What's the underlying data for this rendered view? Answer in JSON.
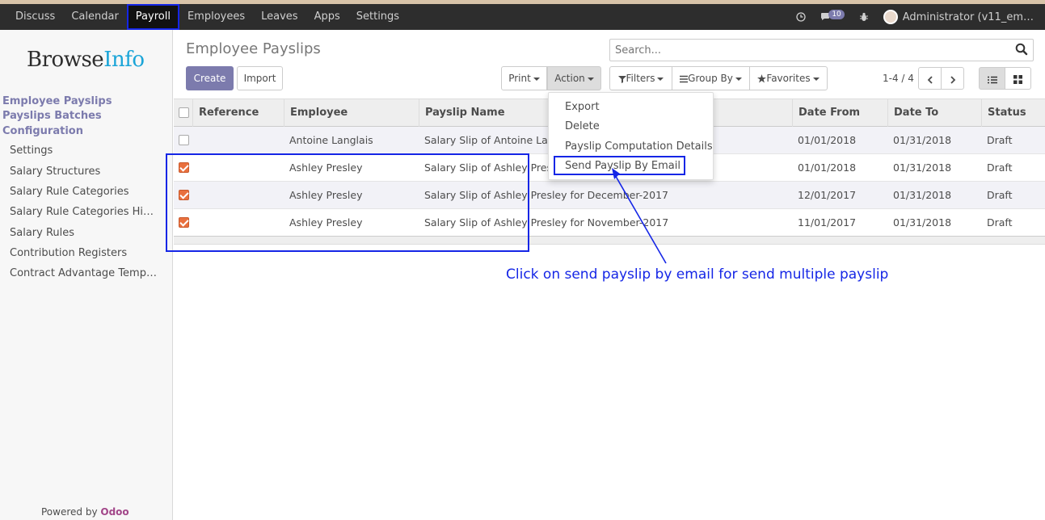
{
  "navbar": {
    "items": [
      "Discuss",
      "Calendar",
      "Payroll",
      "Employees",
      "Leaves",
      "Apps",
      "Settings"
    ],
    "active": "Payroll",
    "message_count": "10",
    "user": "Administrator (v11_em…"
  },
  "sidebar": {
    "logo_part1": "Browse",
    "logo_part2": "Info",
    "headings": [
      "Employee Payslips",
      "Payslips Batches",
      "Configuration"
    ],
    "items": [
      "Settings",
      "Salary Structures",
      "Salary Rule Categories",
      "Salary Rule Categories Hi…",
      "Salary Rules",
      "Contribution Registers",
      "Contract Advantage Temp…"
    ],
    "powered_by": "Powered by",
    "powered_brand": "Odoo"
  },
  "control": {
    "title": "Employee Payslips",
    "search_placeholder": "Search...",
    "create": "Create",
    "import": "Import",
    "print": "Print",
    "action": "Action",
    "filters": "Filters",
    "group_by": "Group By",
    "favorites": "Favorites",
    "pager": "1-4 / 4"
  },
  "table": {
    "headers": [
      "Reference",
      "Employee",
      "Payslip Name",
      "Date From",
      "Date To",
      "Status"
    ],
    "rows": [
      {
        "checked": false,
        "reference": "",
        "employee": "Antoine Langlais",
        "name": "Salary Slip of Antoine Langlais for January-2018",
        "date_from": "01/01/2018",
        "date_to": "01/31/2018",
        "status": "Draft"
      },
      {
        "checked": true,
        "reference": "",
        "employee": "Ashley Presley",
        "name": "Salary Slip of Ashley Presley for January-2018",
        "date_from": "01/01/2018",
        "date_to": "01/31/2018",
        "status": "Draft"
      },
      {
        "checked": true,
        "reference": "",
        "employee": "Ashley Presley",
        "name": "Salary Slip of Ashley Presley for December-2017",
        "date_from": "12/01/2017",
        "date_to": "01/31/2018",
        "status": "Draft"
      },
      {
        "checked": true,
        "reference": "",
        "employee": "Ashley Presley",
        "name": "Salary Slip of Ashley Presley for November-2017",
        "date_from": "11/01/2017",
        "date_to": "01/31/2018",
        "status": "Draft"
      }
    ]
  },
  "action_menu": {
    "items": [
      "Export",
      "Delete",
      "Payslip Computation Details",
      "Send Payslip By Email"
    ]
  },
  "annotation": {
    "text": "Click on send payslip by email for send multiple payslip",
    "color": "#1526e6"
  }
}
